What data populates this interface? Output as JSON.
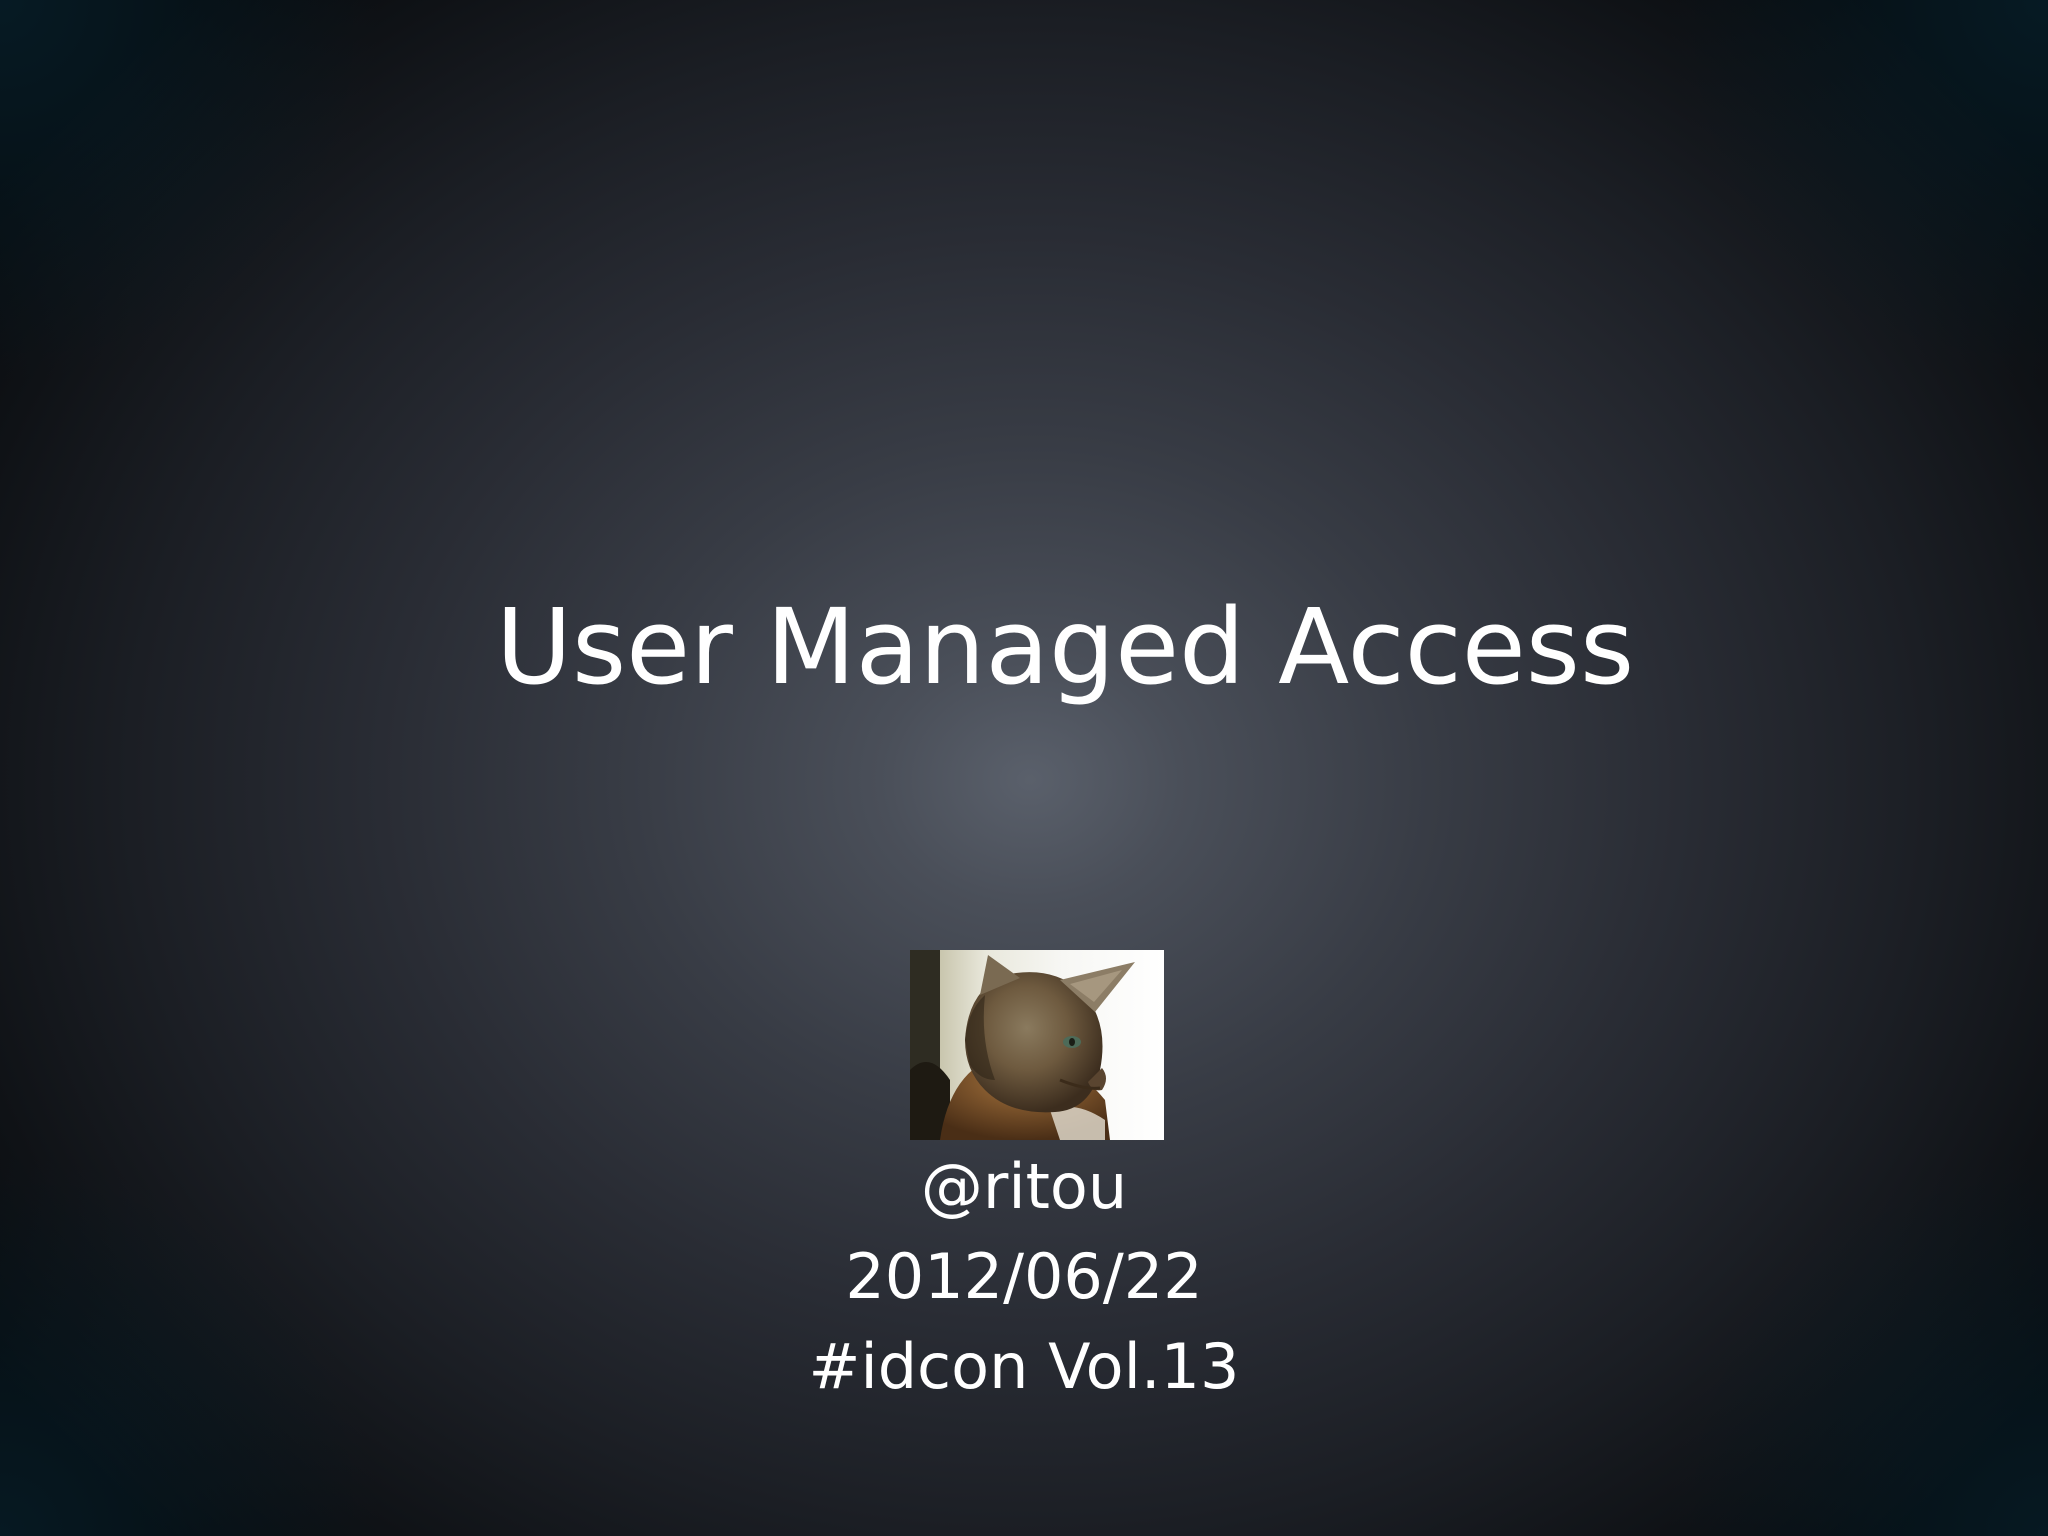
{
  "slide": {
    "title": "User Managed Access",
    "author": "@ritou",
    "date": "2012/06/22",
    "event": "#idcon Vol.13"
  },
  "avatar": {
    "icon": "cat-photo"
  },
  "colors": {
    "text": "#ffffff",
    "background_center": "#5a606b",
    "background_edge": "#070a0d"
  }
}
